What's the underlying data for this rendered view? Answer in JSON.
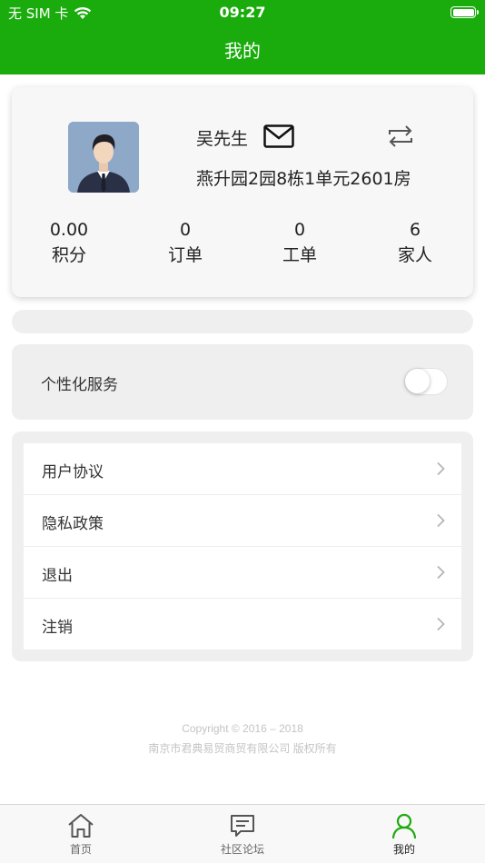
{
  "status_bar": {
    "carrier": "无 SIM 卡",
    "time": "09:27"
  },
  "header": {
    "title": "我的"
  },
  "profile": {
    "name": "吴先生",
    "address": "燕升园2园8栋1单元2601房",
    "mail_icon": "mail-icon",
    "switch_icon": "switch-arrows-icon",
    "stats": [
      {
        "value": "0.00",
        "label": "积分"
      },
      {
        "value": "0",
        "label": "订单"
      },
      {
        "value": "0",
        "label": "工单"
      },
      {
        "value": "6",
        "label": "家人"
      }
    ]
  },
  "service": {
    "label": "个性化服务",
    "enabled": false
  },
  "menu": {
    "items": [
      {
        "label": "用户协议"
      },
      {
        "label": "隐私政策"
      },
      {
        "label": "退出"
      },
      {
        "label": "注销"
      }
    ]
  },
  "footer": {
    "copyright": "Copyright © 2016 – 2018",
    "company": "南京市君典易贸商贸有限公司 版权所有"
  },
  "tabbar": {
    "tabs": [
      {
        "label": "首页",
        "icon": "home-icon",
        "active": false
      },
      {
        "label": "社区论坛",
        "icon": "chat-icon",
        "active": false
      },
      {
        "label": "我的",
        "icon": "person-icon",
        "active": true
      }
    ]
  },
  "colors": {
    "brand_green": "#1aab0c",
    "card_bg": "#efefef"
  }
}
